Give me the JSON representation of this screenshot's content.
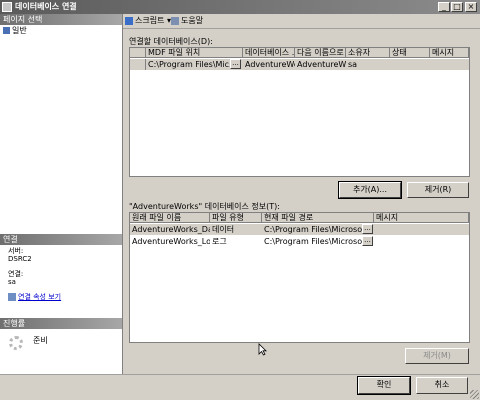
{
  "window": {
    "title": "데이터베이스 연결",
    "minimize": "_",
    "maximize": "□",
    "close": "×"
  },
  "left": {
    "page_select_header": "페이지 선택",
    "pages": [
      {
        "label": "일반"
      }
    ],
    "connection_header": "연결",
    "server_label": "서버:",
    "server_value": "DSRC2",
    "connection_label": "연결:",
    "connection_value": "sa",
    "view_properties_link": "연결 속성 보기",
    "progress_header": "진행률",
    "progress_status": "준비"
  },
  "toolbar": {
    "script_label": "스크립트",
    "script_arrow": "▾",
    "help_label": "도움말"
  },
  "attach": {
    "label": "연결할 데이터베이스(D):",
    "columns": [
      "MDF 파일 위치",
      "데이터베이스 ...",
      "다음 이름으로 ...",
      "소유자",
      "상태",
      "메시지"
    ],
    "rows": [
      {
        "path": "C:\\Program Files\\Mic...",
        "database": "AdventureWo...",
        "attach_as": "AdventureWorks",
        "owner": "sa",
        "status": "",
        "message": ""
      }
    ],
    "add_button": "추가(A)...",
    "remove_button": "제거(R)"
  },
  "details": {
    "label": "\"AdventureWorks\" 데이터베이스 정보(T):",
    "columns": [
      "원래 파일 이름",
      "파일 유형",
      "현재 파일 경로",
      "메시지"
    ],
    "rows": [
      {
        "name": "AdventureWorks_Data....",
        "type": "데이터",
        "path": "C:\\Program Files\\Microsof...",
        "message": ""
      },
      {
        "name": "AdventureWorks_Log.ldf",
        "type": "로그",
        "path": "C:\\Program Files\\Microsof...",
        "message": ""
      }
    ],
    "remove_button": "제거(M)"
  },
  "footer": {
    "ok_button": "확인",
    "cancel_button": "취소"
  },
  "colors": {
    "titlebar": "#6f6f6f",
    "link": "#0000cc",
    "selected_row": "#d4d0c8"
  }
}
